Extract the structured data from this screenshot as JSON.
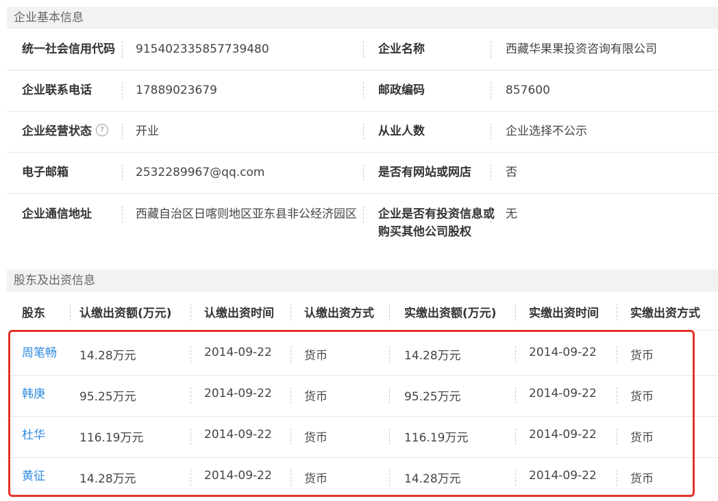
{
  "basic_info": {
    "section_title": "企业基本信息",
    "rows": [
      {
        "l1": "统一社会信用代码",
        "v1": "915402335857739480",
        "l2": "企业名称",
        "v2": "西藏华果果投资咨询有限公司"
      },
      {
        "l1": "企业联系电话",
        "v1": "17889023679",
        "l2": "邮政编码",
        "v2": "857600"
      },
      {
        "l1": "企业经营状态",
        "v1": "开业",
        "l2": "从业人数",
        "v2": "企业选择不公示"
      },
      {
        "l1": "电子邮箱",
        "v1": "2532289967@qq.com",
        "l2": "是否有网站或网店",
        "v2": "否"
      },
      {
        "l1": "企业通信地址",
        "v1": "西藏自治区日喀则地区亚东县非公经济园区",
        "l2": "企业是否有投资信息或购买其他公司股权",
        "v2": "无"
      }
    ],
    "help_icon_glyph": "?"
  },
  "shareholders": {
    "section_title": "股东及出资信息",
    "headers": [
      "股东",
      "认缴出资额(万元)",
      "认缴出资时间",
      "认缴出资方式",
      "实缴出资额(万元)",
      "实缴出资时间",
      "实缴出资方式"
    ],
    "rows": [
      [
        "周笔畅",
        "14.28万元",
        "2014-09-22",
        "货币",
        "14.28万元",
        "2014-09-22",
        "货币"
      ],
      [
        "韩庚",
        "95.25万元",
        "2014-09-22",
        "货币",
        "95.25万元",
        "2014-09-22",
        "货币"
      ],
      [
        "杜华",
        "116.19万元",
        "2014-09-22",
        "货币",
        "116.19万元",
        "2014-09-22",
        "货币"
      ],
      [
        "黄征",
        "14.28万元",
        "2014-09-22",
        "货币",
        "14.28万元",
        "2014-09-22",
        "货币"
      ]
    ]
  },
  "colors": {
    "highlight": "#e33226",
    "link": "#2f8be0"
  }
}
